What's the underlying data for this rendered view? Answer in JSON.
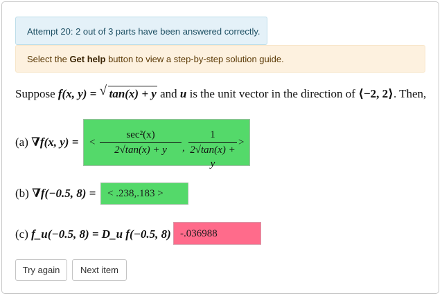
{
  "attempt_message": "Attempt 20: 2 out of 3 parts have been answered correctly.",
  "help": {
    "prefix": "Select the ",
    "bold": "Get help",
    "suffix": " button to view a step-by-step solution guide."
  },
  "statement": {
    "suppose": "Suppose ",
    "f_def": "f(x, y) = ",
    "sqrt_content": "tan(x) + y",
    "and": " and ",
    "u": "u",
    "unit_vec": " is the unit vector in the direction of ",
    "direction": "⟨−2, 2⟩",
    "then": ". Then,"
  },
  "parts": {
    "a": {
      "label": "(a) ",
      "expr": "∇f(x, y) = ",
      "open": "<",
      "frac1_num": "sec²(x)",
      "frac1_den": "2√tan(x) + y",
      "comma": ",",
      "frac2_num": "1",
      "frac2_den": "2√tan(x) + y",
      "close": ">",
      "status": "correct"
    },
    "b": {
      "label": "(b) ",
      "expr": "∇f(−0.5, 8) = ",
      "answer": "< .238,.183 >",
      "status": "correct"
    },
    "c": {
      "label": "(c) ",
      "expr": "f_u(−0.5, 8) = D_u f(−0.5, 8) = ",
      "answer": "-.036988",
      "status": "incorrect"
    }
  },
  "buttons": {
    "try_again": "Try again",
    "next_item": "Next item"
  },
  "colors": {
    "correct": "#54d96a",
    "incorrect": "#ff6b8b",
    "info_bg": "#e4f1f8",
    "warn_bg": "#fdf1df"
  }
}
